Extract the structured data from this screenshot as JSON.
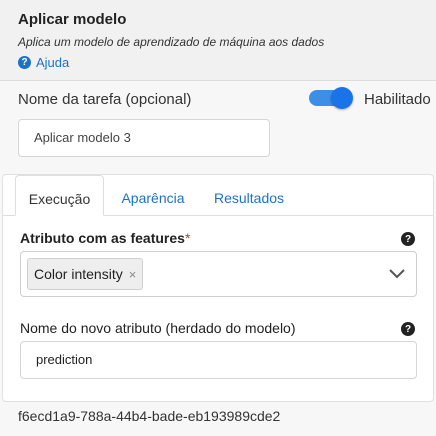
{
  "header": {
    "title": "Aplicar modelo",
    "subtitle": "Aplica um modelo de aprendizado de máquina aos dados",
    "help_label": "Ajuda"
  },
  "task": {
    "name_label": "Nome da tarefa (opcional)",
    "name_value": "Aplicar modelo 3",
    "enabled_label": "Habilitado",
    "enabled": true
  },
  "tabs": [
    {
      "label": "Execução",
      "active": true
    },
    {
      "label": "Aparência",
      "active": false
    },
    {
      "label": "Resultados",
      "active": false
    }
  ],
  "features_field": {
    "label": "Atributo com as features",
    "required_mark": "*",
    "selected": [
      "Color intensity"
    ],
    "remove_glyph": "×"
  },
  "new_attribute_field": {
    "label": "Nome do novo atributo (herdado do modelo)",
    "value": "prediction"
  },
  "task_id": "f6ecd1a9-788a-44b4-bade-eb193989cde2",
  "colors": {
    "accent": "#1a73e8",
    "link": "#1a73c9",
    "required": "#c0392b"
  }
}
